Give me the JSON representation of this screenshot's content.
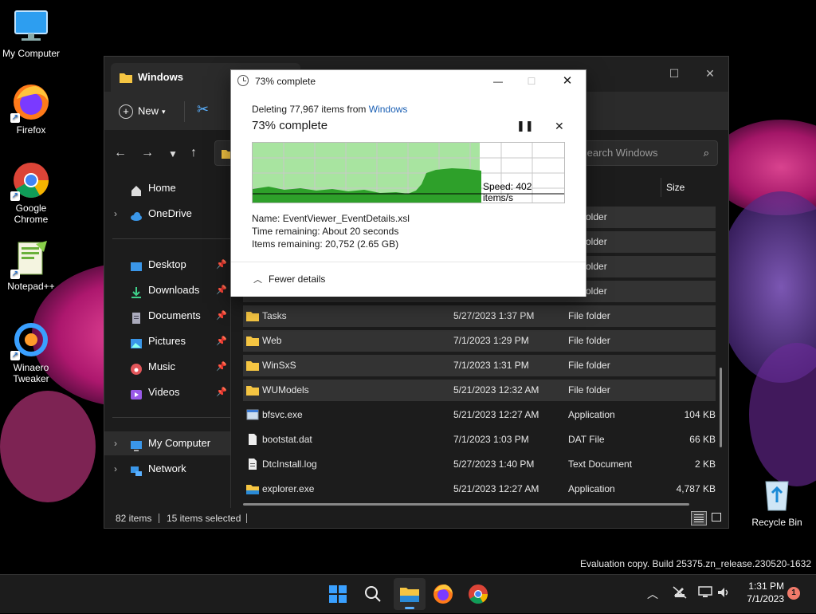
{
  "desktop": {
    "icons": [
      {
        "label": "My Computer"
      },
      {
        "label": "Firefox"
      },
      {
        "label": "Google Chrome"
      },
      {
        "label": "Notepad++"
      },
      {
        "label": "Winaero Tweaker"
      },
      {
        "label": "Recycle Bin"
      }
    ],
    "watermark": "Evaluation copy. Build 25375.zn_release.230520-1632"
  },
  "explorer": {
    "tab_title": "Windows",
    "new_label": "New",
    "search_placeholder": "Search Windows",
    "size_header": "Size",
    "sidebar": {
      "home": "Home",
      "onedrive": "OneDrive",
      "quick": [
        {
          "label": "Desktop"
        },
        {
          "label": "Downloads"
        },
        {
          "label": "Documents"
        },
        {
          "label": "Pictures"
        },
        {
          "label": "Music"
        },
        {
          "label": "Videos"
        }
      ],
      "my_computer": "My Computer",
      "network": "Network"
    },
    "partial_rows": [
      "older",
      "older",
      "older",
      "older"
    ],
    "rows": [
      {
        "name": "Tasks",
        "date": "5/27/2023 1:37 PM",
        "type": "File folder",
        "size": "",
        "selected": true,
        "kind": "folder"
      },
      {
        "name": "Web",
        "date": "7/1/2023 1:29 PM",
        "type": "File folder",
        "size": "",
        "selected": true,
        "kind": "folder"
      },
      {
        "name": "WinSxS",
        "date": "7/1/2023 1:31 PM",
        "type": "File folder",
        "size": "",
        "selected": true,
        "kind": "folder"
      },
      {
        "name": "WUModels",
        "date": "5/21/2023 12:32 AM",
        "type": "File folder",
        "size": "",
        "selected": true,
        "kind": "folder"
      },
      {
        "name": "bfsvc.exe",
        "date": "5/21/2023 12:27 AM",
        "type": "Application",
        "size": "104 KB",
        "selected": false,
        "kind": "exe"
      },
      {
        "name": "bootstat.dat",
        "date": "7/1/2023 1:03 PM",
        "type": "DAT File",
        "size": "66 KB",
        "selected": false,
        "kind": "file"
      },
      {
        "name": "DtcInstall.log",
        "date": "5/27/2023 1:40 PM",
        "type": "Text Document",
        "size": "2 KB",
        "selected": false,
        "kind": "text"
      },
      {
        "name": "explorer.exe",
        "date": "5/21/2023 12:27 AM",
        "type": "Application",
        "size": "4,787 KB",
        "selected": false,
        "kind": "folder-exe"
      }
    ],
    "status": {
      "items": "82 items",
      "selected": "15 items selected"
    }
  },
  "dialog": {
    "title": "73% complete",
    "deleting_prefix": "Deleting 77,967 items from",
    "deleting_link": "Windows",
    "heading": "73% complete",
    "progress": 0.73,
    "speed": "Speed: 402 items/s",
    "name_label": "Name:",
    "name_value": "EventViewer_EventDetails.xsl",
    "time_label": "Time remaining:",
    "time_value": "About 20 seconds",
    "items_label": "Items remaining:",
    "items_value": "20,752 (2.65 GB)",
    "fewer_details": "Fewer details"
  },
  "taskbar": {
    "time": "1:31 PM",
    "date": "7/1/2023",
    "badge": "1"
  }
}
